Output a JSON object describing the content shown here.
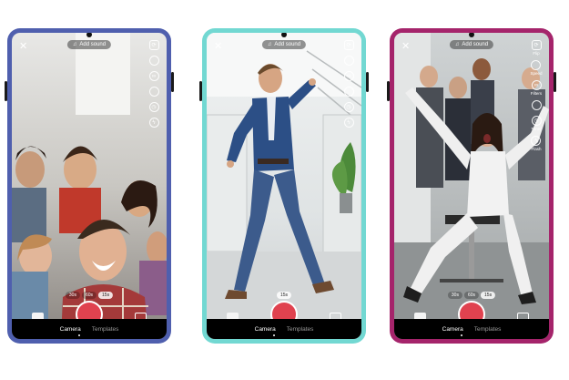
{
  "frame_colors": [
    "#4f5fae",
    "#72d8d2",
    "#a5246b"
  ],
  "phones": [
    {
      "add_sound": "Add sound",
      "tools": [
        {
          "icon": "flip-icon",
          "label": ""
        },
        {
          "icon": "speed-icon",
          "label": ""
        },
        {
          "icon": "filters-icon",
          "label": ""
        },
        {
          "icon": "beauty-icon",
          "label": ""
        },
        {
          "icon": "timer-icon",
          "label": ""
        },
        {
          "icon": "flash-icon",
          "label": ""
        }
      ],
      "speeds": [
        "30s",
        "60s",
        "15s"
      ],
      "selected_speed": "15s",
      "effects_label": "Effects",
      "gallery_label": "Upload",
      "tabs": [
        "Camera",
        "Templates"
      ]
    },
    {
      "add_sound": "Add sound",
      "tools": [
        {
          "icon": "flip-icon",
          "label": ""
        },
        {
          "icon": "speed-icon",
          "label": ""
        },
        {
          "icon": "filters-icon",
          "label": ""
        },
        {
          "icon": "beauty-icon",
          "label": ""
        },
        {
          "icon": "timer-icon",
          "label": ""
        },
        {
          "icon": "flash-icon",
          "label": ""
        }
      ],
      "speeds": [
        "15s"
      ],
      "selected_speed": "15s",
      "effects_label": "Effects",
      "gallery_label": "Upload",
      "tabs": [
        "Camera",
        "Templates"
      ]
    },
    {
      "add_sound": "Add sound",
      "tools": [
        {
          "icon": "flip-icon",
          "label": "Flip"
        },
        {
          "icon": "speed-icon",
          "label": "Speed"
        },
        {
          "icon": "filters-icon",
          "label": "Filters"
        },
        {
          "icon": "beauty-icon",
          "label": ""
        },
        {
          "icon": "timer-icon",
          "label": "Timer"
        },
        {
          "icon": "flash-icon",
          "label": "Flash"
        }
      ],
      "speeds": [
        "30s",
        "60s",
        "15s"
      ],
      "selected_speed": "15s",
      "effects_label": "Effects",
      "gallery_label": "Upload",
      "tabs": [
        "Camera",
        "Templates"
      ]
    }
  ]
}
